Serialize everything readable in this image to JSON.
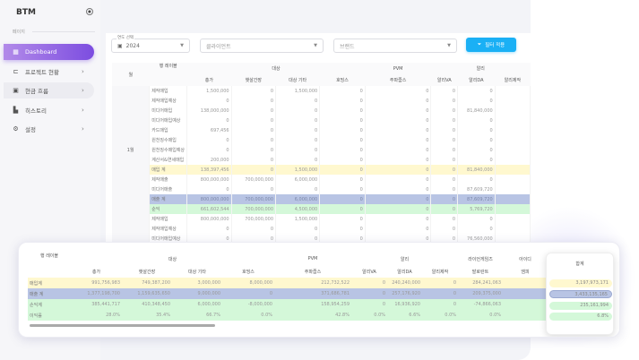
{
  "sidebar": {
    "brand": "BTM",
    "section": "페이지",
    "items": [
      {
        "label": "Dashboard",
        "icon": "dashboard-icon",
        "glyph": "▦"
      },
      {
        "label": "프로젝트 현황",
        "icon": "project-icon",
        "glyph": "⊏"
      },
      {
        "label": "현금 흐름",
        "icon": "calendar-icon",
        "glyph": "▣"
      },
      {
        "label": "히스토리",
        "icon": "history-icon",
        "glyph": "▙"
      },
      {
        "label": "설정",
        "icon": "gear-icon",
        "glyph": "⚙"
      }
    ]
  },
  "filters": {
    "year_label": "연도 선택",
    "year": "2024",
    "client_placeholder": "클라이언트",
    "brand_placeholder": "브랜드",
    "apply": "필터 적용"
  },
  "colors": {
    "accent": "#7c4de0",
    "button": "#1ab0f5",
    "purchase_total": "#fff8cf",
    "sales_total": "#b8c4e4",
    "profit": "#d4f8d9"
  },
  "main_table": {
    "headers": {
      "month": "월",
      "row_label": "행 레이블",
      "groups": [
        "대상",
        "PVM",
        "알리"
      ],
      "columns": [
        "총가",
        "햇살간장",
        "대상 기타",
        "호밍스",
        "주파줍스",
        "알리VA",
        "알리DA",
        "알리제작"
      ]
    },
    "month": "1월",
    "rows": [
      {
        "label": "제작매입",
        "values": [
          "1,500,000",
          "0",
          "1,500,000",
          "0",
          "0",
          "0",
          "0",
          ""
        ]
      },
      {
        "label": "제작매입예상",
        "values": [
          "0",
          "0",
          "0",
          "0",
          "0",
          "0",
          "0",
          ""
        ]
      },
      {
        "label": "미디어매입",
        "values": [
          "138,000,000",
          "0",
          "0",
          "0",
          "0",
          "0",
          "81,840,000",
          ""
        ]
      },
      {
        "label": "미디어매입예상",
        "values": [
          "0",
          "0",
          "0",
          "0",
          "0",
          "0",
          "0",
          ""
        ]
      },
      {
        "label": "카드매입",
        "values": [
          "697,456",
          "0",
          "0",
          "0",
          "0",
          "0",
          "0",
          ""
        ]
      },
      {
        "label": "원천징수매입",
        "values": [
          "0",
          "0",
          "0",
          "0",
          "0",
          "0",
          "0",
          ""
        ]
      },
      {
        "label": "원천징수매입예상",
        "values": [
          "0",
          "0",
          "0",
          "0",
          "0",
          "0",
          "0",
          ""
        ]
      },
      {
        "label": "계산서&연세매입",
        "values": [
          "200,000",
          "0",
          "0",
          "0",
          "0",
          "0",
          "0",
          ""
        ]
      },
      {
        "label": "매입 계",
        "type": "yel",
        "values": [
          "138,397,456",
          "0",
          "1,500,000",
          "0",
          "0",
          "0",
          "81,840,000",
          ""
        ]
      },
      {
        "label": "제작매출",
        "values": [
          "800,000,000",
          "700,000,000",
          "6,000,000",
          "0",
          "0",
          "0",
          "0",
          ""
        ]
      },
      {
        "label": "미디어매출",
        "values": [
          "0",
          "0",
          "0",
          "0",
          "0",
          "0",
          "87,609,720",
          ""
        ]
      },
      {
        "label": "매출 계",
        "type": "blu",
        "values": [
          "800,000,000",
          "700,000,000",
          "6,000,000",
          "0",
          "0",
          "0",
          "87,609,720",
          ""
        ]
      },
      {
        "label": "순익",
        "type": "grn",
        "values": [
          "661,602,544",
          "700,000,000",
          "4,500,000",
          "0",
          "0",
          "0",
          "5,769,720",
          ""
        ]
      },
      {
        "label": "제작매입",
        "values": [
          "800,000,000",
          "700,000,000",
          "1,500,000",
          "0",
          "0",
          "0",
          "0",
          ""
        ]
      },
      {
        "label": "제작매입예상",
        "values": [
          "0",
          "0",
          "0",
          "0",
          "0",
          "0",
          "0",
          ""
        ]
      },
      {
        "label": "미디어매입예상",
        "values": [
          "0",
          "0",
          "0",
          "0",
          "0",
          "0",
          "76,560,000",
          ""
        ]
      }
    ]
  },
  "summary_table": {
    "headers": {
      "row_label": "행 레이블",
      "groups": [
        "대상",
        "PVM",
        "알리",
        "라이언게임즈",
        "아이디"
      ],
      "columns": [
        "총가",
        "햇살간장",
        "대상 기타",
        "호밍스",
        "주파줍스",
        "알리VA",
        "알리DA",
        "알리제작",
        "발로란트",
        "엠피"
      ]
    },
    "rows": [
      {
        "label": "매입계",
        "type": "yel",
        "values": [
          "991,756,983",
          "749,387,200",
          "3,000,000",
          "8,000,000",
          "212,732,522",
          "0",
          "240,240,000",
          "0",
          "284,241,063",
          ""
        ]
      },
      {
        "label": "매출 계",
        "type": "blu",
        "values": [
          "1,377,198,700",
          "1,159,635,650",
          "9,000,000",
          "0",
          "371,686,781",
          "0",
          "257,176,920",
          "0",
          "209,375,000",
          ""
        ]
      },
      {
        "label": "손익계",
        "type": "grn",
        "values": [
          "385,441,717",
          "410,348,450",
          "6,000,000",
          "-8,000,000",
          "158,954,259",
          "0",
          "16,936,920",
          "0",
          "-74,866,063",
          ""
        ]
      },
      {
        "label": "이익률",
        "type": "grn",
        "values": [
          "28.0%",
          "35.4%",
          "66.7%",
          "0.0%",
          "42.8%",
          "0.0%",
          "6.6%",
          "0.0%",
          "0.0%",
          ""
        ]
      }
    ],
    "total_header": "합계",
    "totals": [
      "3,197,973,171",
      "3,433,135,165",
      "235,161,994",
      "6.8%"
    ]
  }
}
